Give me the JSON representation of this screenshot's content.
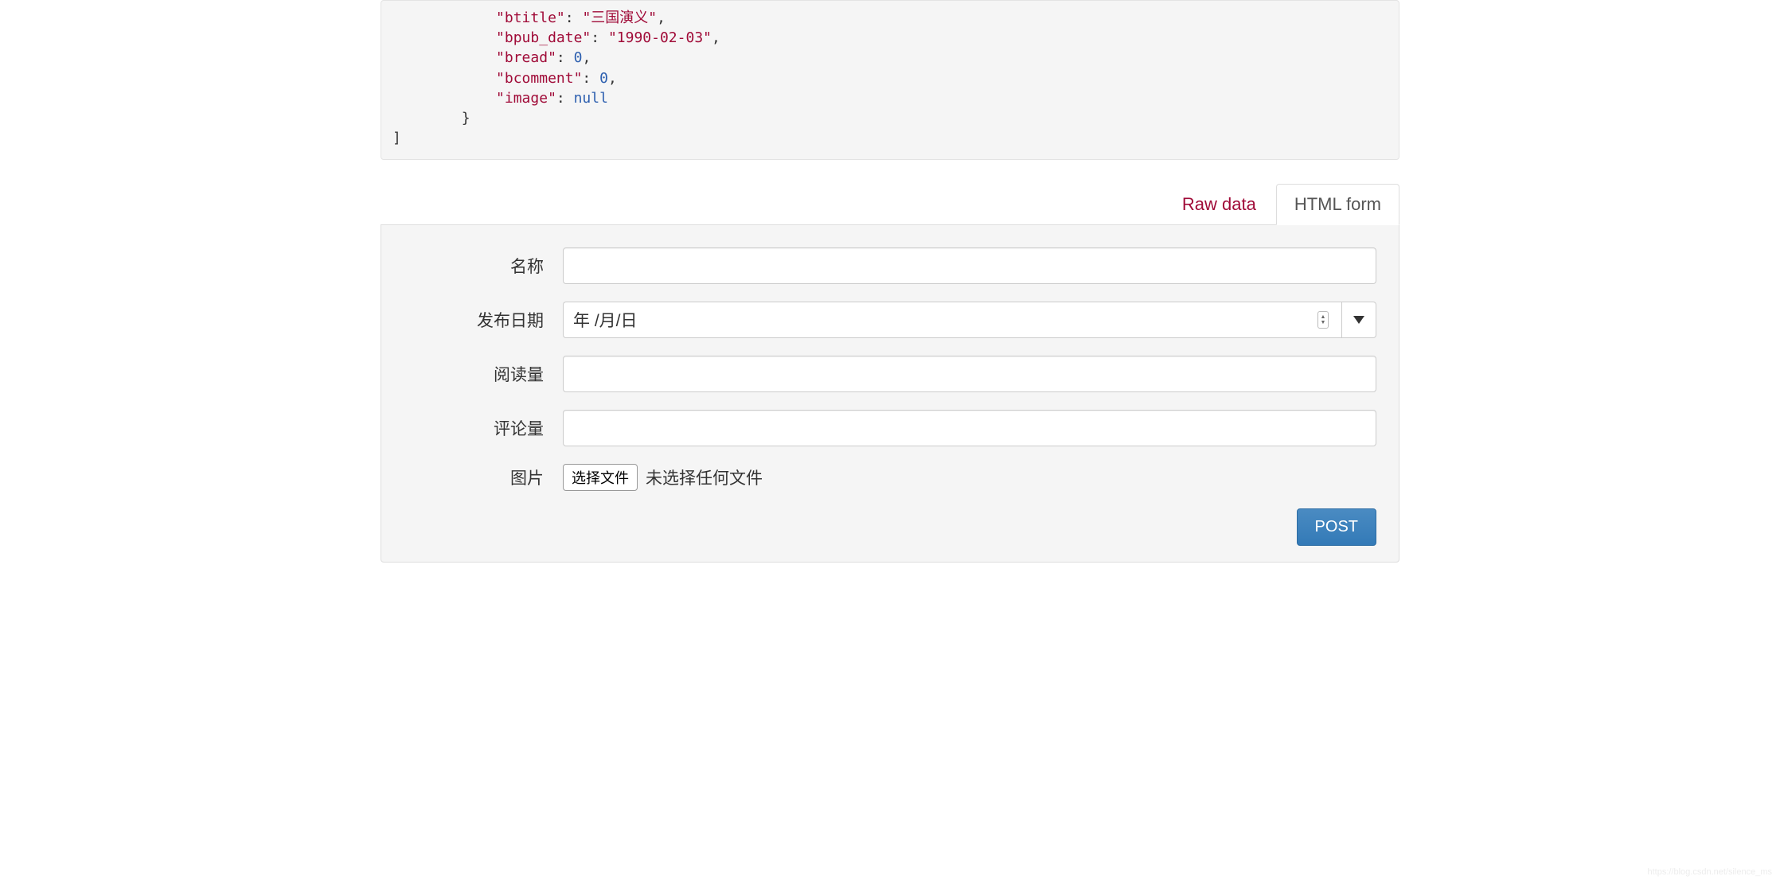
{
  "response": {
    "lines": [
      {
        "indent": 3,
        "tokens": [
          {
            "t": "key",
            "v": "\"btitle\""
          },
          {
            "t": "punct",
            "v": ": "
          },
          {
            "t": "string",
            "v": "\"三国演义\""
          },
          {
            "t": "punct",
            "v": ","
          }
        ]
      },
      {
        "indent": 3,
        "tokens": [
          {
            "t": "key",
            "v": "\"bpub_date\""
          },
          {
            "t": "punct",
            "v": ": "
          },
          {
            "t": "string",
            "v": "\"1990-02-03\""
          },
          {
            "t": "punct",
            "v": ","
          }
        ]
      },
      {
        "indent": 3,
        "tokens": [
          {
            "t": "key",
            "v": "\"bread\""
          },
          {
            "t": "punct",
            "v": ": "
          },
          {
            "t": "number",
            "v": "0"
          },
          {
            "t": "punct",
            "v": ","
          }
        ]
      },
      {
        "indent": 3,
        "tokens": [
          {
            "t": "key",
            "v": "\"bcomment\""
          },
          {
            "t": "punct",
            "v": ": "
          },
          {
            "t": "number",
            "v": "0"
          },
          {
            "t": "punct",
            "v": ","
          }
        ]
      },
      {
        "indent": 3,
        "tokens": [
          {
            "t": "key",
            "v": "\"image\""
          },
          {
            "t": "punct",
            "v": ": "
          },
          {
            "t": "null",
            "v": "null"
          }
        ]
      },
      {
        "indent": 2,
        "tokens": [
          {
            "t": "punct",
            "v": "}"
          }
        ]
      },
      {
        "indent": 0,
        "tokens": [
          {
            "t": "punct",
            "v": "]"
          }
        ]
      }
    ]
  },
  "tabs": {
    "raw_data": "Raw data",
    "html_form": "HTML form"
  },
  "form": {
    "fields": {
      "name": {
        "label": "名称",
        "value": ""
      },
      "pub_date": {
        "label": "发布日期",
        "placeholder": "年 /月/日"
      },
      "read": {
        "label": "阅读量",
        "value": ""
      },
      "comment": {
        "label": "评论量",
        "value": ""
      },
      "image": {
        "label": "图片",
        "button": "选择文件",
        "status": "未选择任何文件"
      }
    },
    "submit": "POST"
  },
  "watermark": "https://blog.csdn.net/silence_ms"
}
